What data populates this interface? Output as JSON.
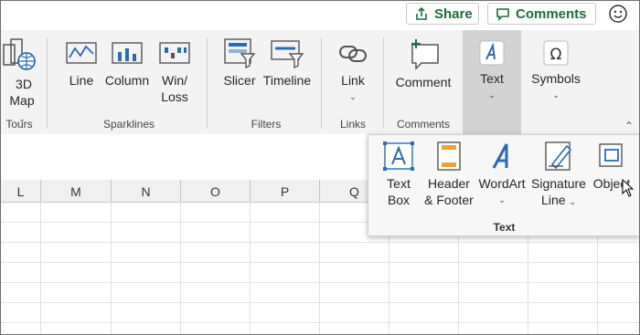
{
  "topbar": {
    "share_label": "Share",
    "comments_label": "Comments"
  },
  "ribbon": {
    "groups": {
      "tours": {
        "label": "Tours",
        "buttons": [
          {
            "label_line1": "3D",
            "label_line2": "Map"
          }
        ]
      },
      "sparklines": {
        "label": "Sparklines",
        "buttons": [
          {
            "label": "Line"
          },
          {
            "label": "Column"
          },
          {
            "label_line1": "Win/",
            "label_line2": "Loss"
          }
        ]
      },
      "filters": {
        "label": "Filters",
        "buttons": [
          {
            "label": "Slicer"
          },
          {
            "label": "Timeline"
          }
        ]
      },
      "links": {
        "label": "Links",
        "buttons": [
          {
            "label": "Link"
          }
        ]
      },
      "comments": {
        "label": "Comments",
        "buttons": [
          {
            "label": "Comment"
          }
        ]
      },
      "text": {
        "buttons": [
          {
            "label": "Text"
          }
        ]
      },
      "symbols": {
        "buttons": [
          {
            "label": "Symbols"
          }
        ]
      }
    }
  },
  "grid": {
    "columns": [
      "L",
      "M",
      "N",
      "O",
      "P",
      "Q"
    ]
  },
  "text_panel": {
    "label": "Text",
    "buttons": [
      {
        "label_line1": "Text",
        "label_line2": "Box"
      },
      {
        "label_line1": "Header",
        "label_line2": "& Footer"
      },
      {
        "label_line1": "WordArt"
      },
      {
        "label_line1": "Signature",
        "label_line2": "Line"
      },
      {
        "label_line1": "Object"
      }
    ]
  },
  "colors": {
    "accent_green": "#1e6b3a",
    "icon_blue": "#2b6cb0",
    "highlight": "#d3d3d3"
  }
}
